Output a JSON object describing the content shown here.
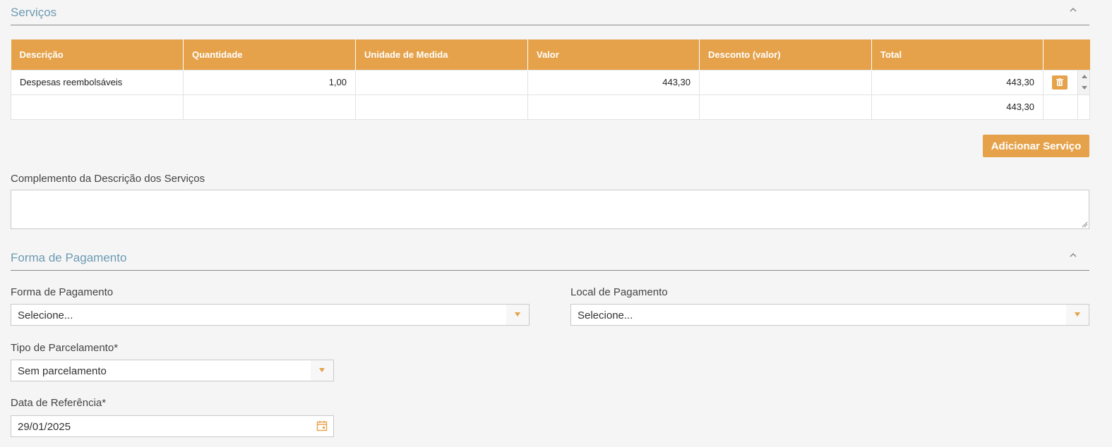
{
  "servicos": {
    "title": "Serviços",
    "columns": [
      "Descrição",
      "Quantidade",
      "Unidade de Medida",
      "Valor",
      "Desconto (valor)",
      "Total",
      ""
    ],
    "rows": [
      {
        "descricao": "Despesas reembolsáveis",
        "quantidade": "1,00",
        "unidade": "",
        "valor": "443,30",
        "desconto": "",
        "total": "443,30"
      }
    ],
    "footer": {
      "total": "443,30"
    },
    "add_button": "Adicionar Serviço",
    "complemento_label": "Complemento da Descrição dos Serviços",
    "complemento_value": ""
  },
  "pagamento": {
    "title": "Forma de Pagamento",
    "forma_label": "Forma de Pagamento",
    "forma_value": "Selecione...",
    "local_label": "Local de Pagamento",
    "local_value": "Selecione...",
    "parcelamento_label": "Tipo de Parcelamento*",
    "parcelamento_value": "Sem parcelamento",
    "data_label": "Data de Referência*",
    "data_value": "29/01/2025"
  },
  "icons": {
    "collapse": "chevron-up-icon",
    "delete": "trash-icon",
    "dropdown": "caret-down-icon",
    "calendar": "calendar-icon"
  },
  "colors": {
    "accent": "#e5a24a",
    "section_title": "#6d9bb3"
  }
}
